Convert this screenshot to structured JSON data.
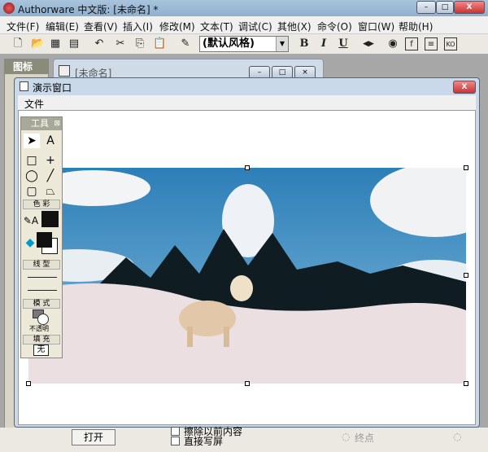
{
  "app": {
    "title": "Authorware 中文版: [未命名] *",
    "min": "–",
    "max": "□",
    "close": "X"
  },
  "menu": [
    "文件(F)",
    "编辑(E)",
    "查看(V)",
    "插入(I)",
    "修改(M)",
    "文本(T)",
    "调试(C)",
    "其他(X)",
    "命令(O)",
    "窗口(W)",
    "帮助(H)"
  ],
  "toolbar": {
    "style_value": "(默认风格)",
    "bold": "B",
    "italic": "I",
    "underline": "U"
  },
  "icon_palette": {
    "title": "图标"
  },
  "flow_window": {
    "title": "[未命名]"
  },
  "demo_window": {
    "title": "演示窗口",
    "menu": "文件",
    "close": "X"
  },
  "toolbox": {
    "title": "工具",
    "color_section": "色 彩",
    "line_section": "线 型",
    "mode_section": "模 式",
    "mode_value": "不透明",
    "fill_section": "填 充",
    "fill_value": "无"
  },
  "bottom": {
    "open_button": "打开",
    "erase_label": "擦除以前内容",
    "direct_label": "直接写屏",
    "endpoint_label": "终点"
  },
  "colors": {
    "titlebar": "#9bb8d4",
    "toolbox_header": "#a8a898"
  }
}
